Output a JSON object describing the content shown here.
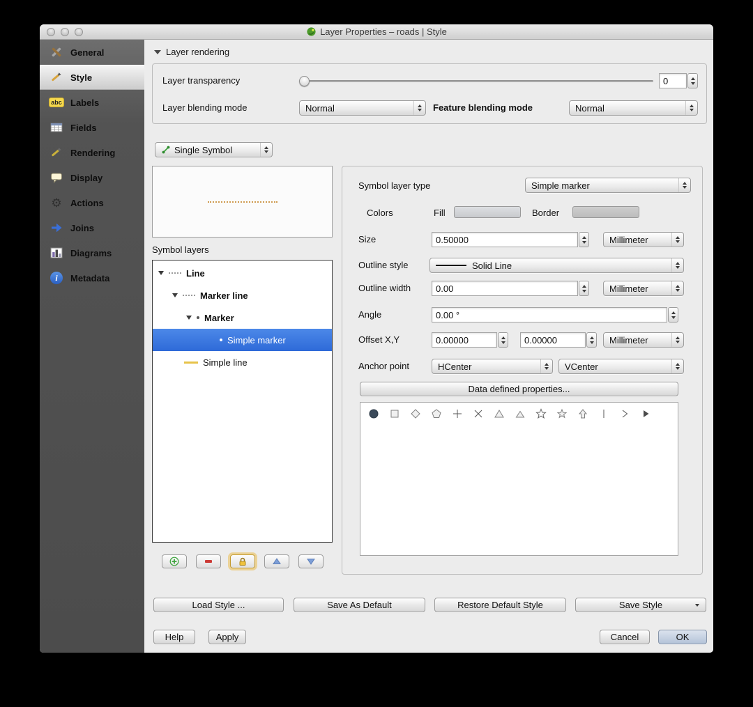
{
  "window": {
    "title": "Layer Properties – roads | Style"
  },
  "sidebar": {
    "items": [
      {
        "label": "General"
      },
      {
        "label": "Style"
      },
      {
        "label": "Labels",
        "icon_text": "abc"
      },
      {
        "label": "Fields"
      },
      {
        "label": "Rendering"
      },
      {
        "label": "Display"
      },
      {
        "label": "Actions"
      },
      {
        "label": "Joins"
      },
      {
        "label": "Diagrams"
      },
      {
        "label": "Metadata",
        "icon_text": "i"
      }
    ]
  },
  "rendering": {
    "header": "Layer rendering",
    "transparency_label": "Layer transparency",
    "transparency_value": "0",
    "layer_blend_label": "Layer blending mode",
    "layer_blend_value": "Normal",
    "feature_blend_label": "Feature blending mode",
    "feature_blend_value": "Normal"
  },
  "symbol": {
    "renderer_value": "Single Symbol",
    "layers_label": "Symbol layers",
    "tree": [
      {
        "label": "Line"
      },
      {
        "label": "Marker line"
      },
      {
        "label": "Marker"
      },
      {
        "label": "Simple marker",
        "selected": true
      },
      {
        "label": "Simple line"
      }
    ]
  },
  "props": {
    "type_label": "Symbol layer type",
    "type_value": "Simple marker",
    "colors_label": "Colors",
    "fill_label": "Fill",
    "border_label": "Border",
    "size_label": "Size",
    "size_value": "0.50000",
    "size_unit": "Millimeter",
    "outline_style_label": "Outline style",
    "outline_style_value": "Solid Line",
    "outline_width_label": "Outline width",
    "outline_width_value": "0.00",
    "outline_width_unit": "Millimeter",
    "angle_label": "Angle",
    "angle_value": "0.00 °",
    "offset_label": "Offset X,Y",
    "offset_x_value": "0.00000",
    "offset_y_value": "0.00000",
    "offset_unit": "Millimeter",
    "anchor_label": "Anchor point",
    "anchor_h_value": "HCenter",
    "anchor_v_value": "VCenter",
    "data_defined_label": "Data defined properties..."
  },
  "marker_shapes": [
    "circle",
    "square",
    "diamond",
    "pentagon",
    "cross-plus",
    "cross-x",
    "triangle",
    "equilateral-triangle",
    "star",
    "regular-star",
    "arrow-up",
    "vertical-line",
    "chevron-right",
    "filled-arrowhead"
  ],
  "footer": {
    "load_style": "Load Style ...",
    "save_as_default": "Save As Default",
    "restore_default": "Restore Default Style",
    "save_style": "Save Style",
    "help": "Help",
    "apply": "Apply",
    "cancel": "Cancel",
    "ok": "OK"
  },
  "colors": {
    "selection_blue": "#3b78dd",
    "sidebar_gray": "#545454",
    "window_bg": "#ececec",
    "lock_gold": "#e6b83c",
    "add_green": "#3aa33a",
    "remove_red": "#cc3b36"
  }
}
